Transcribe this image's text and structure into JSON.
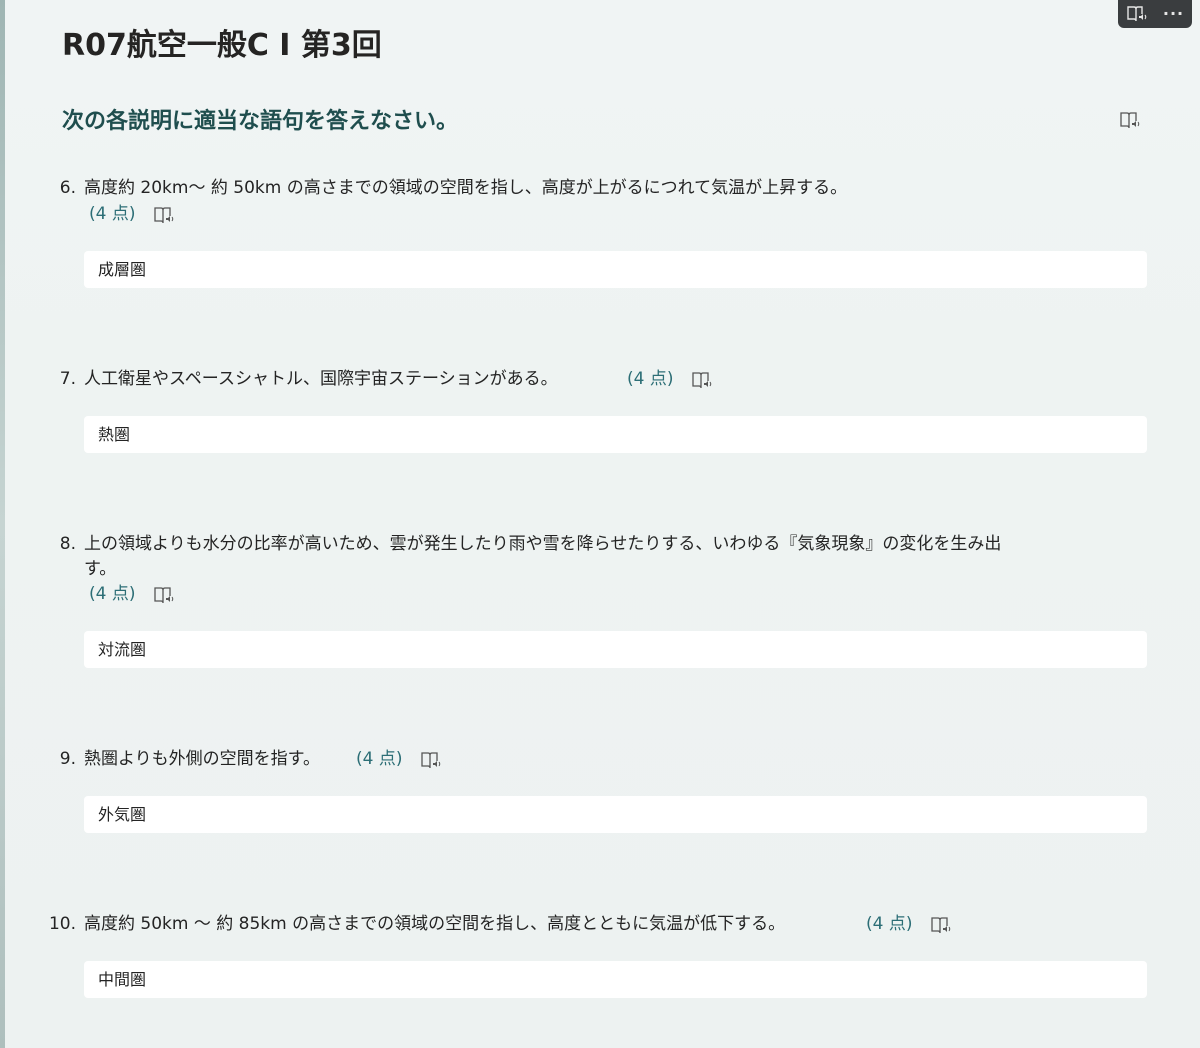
{
  "form_title": "R07航空一般C Ⅰ 第3回",
  "section_title": "次の各説明に適当な語句を答えなさい。",
  "topbar": {
    "reader_icon": "immersive-reader-icon",
    "more_label": "···"
  },
  "questions": [
    {
      "number": "6.",
      "text": "高度約 20km〜 約 50km の高さまでの領域の空間を指し、高度が上がるにつれて気温が上昇する。",
      "points": "(4 点)",
      "answer": "成層圏"
    },
    {
      "number": "7.",
      "text": "人工衛星やスペースシャトル、国際宇宙ステーションがある。",
      "points": "(4 点)",
      "answer": "熱圏"
    },
    {
      "number": "8.",
      "text": "上の領域よりも水分の比率が高いため、雲が発生したり雨や雪を降らせたりする、いわゆる『気象現象』の変化を生み出",
      "text_cont": "す。",
      "points": "(4 点)",
      "answer": "対流圏"
    },
    {
      "number": "9.",
      "text": "熱圏よりも外側の空間を指す。",
      "points": "(4 点)",
      "answer": "外気圏"
    },
    {
      "number": "10.",
      "text": "高度約 50km 〜 約 85km の高さまでの領域の空間を指し、高度とともに気温が低下する。",
      "points": "(4 点)",
      "answer": "中間圏"
    }
  ]
}
